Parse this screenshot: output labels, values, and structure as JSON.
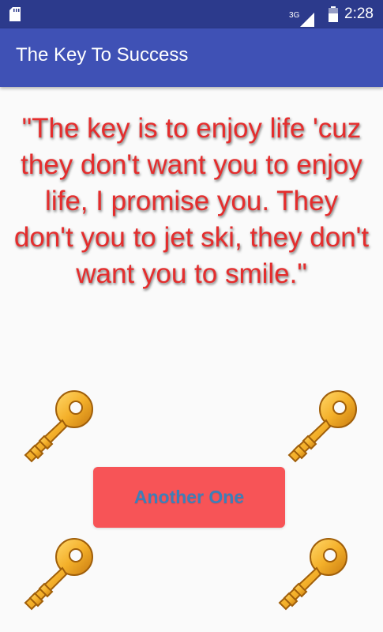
{
  "status_bar": {
    "time": "2:28",
    "network": "3G",
    "icons": [
      "sd-card-icon",
      "signal-icon",
      "battery-icon"
    ]
  },
  "app_bar": {
    "title": "The Key To Success"
  },
  "quote": {
    "text": "\"The key is to enjoy life 'cuz they don't want you to enjoy life, I promise you. They don't you to jet ski, they don't want you to smile.\""
  },
  "button": {
    "label": "Another One"
  },
  "colors": {
    "status_bar": "#2c3a8c",
    "app_bar": "#3f51b5",
    "quote_text": "#e52d2d",
    "button_bg": "#f75457",
    "button_text": "#3d7fb8"
  },
  "decorations": [
    "key-icon",
    "key-icon",
    "key-icon",
    "key-icon"
  ]
}
